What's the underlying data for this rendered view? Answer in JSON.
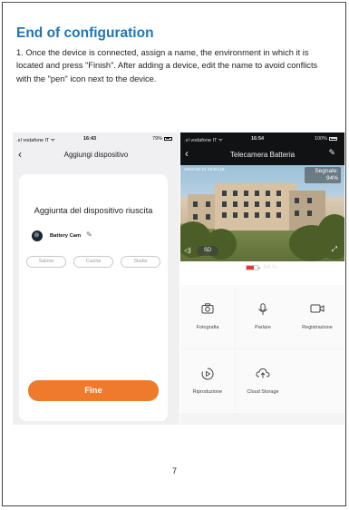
{
  "document": {
    "heading": "End of configuration",
    "intro": "1. Once the device is connected, assign a name, the environment in which it is located and press \"Finish\". After adding a device, edit the name to avoid conflicts with the \"pen\" icon next to the device.",
    "page_number": "7"
  },
  "left_phone": {
    "status_bar": {
      "carrier": ".ııl vodafone IT ᯤ",
      "time": "16:43",
      "battery": "79%"
    },
    "title": "Aggiungi dispositivo",
    "back_icon": "chevron-left-icon",
    "success_text": "Aggiunta del dispositivo riuscita",
    "device_name": "Battery Cam",
    "pen_icon": "pen-icon",
    "rooms": [
      "Salone",
      "Cucina",
      "Studio"
    ],
    "finish_button": "Fine",
    "accent_color": "#f07a2c"
  },
  "right_phone": {
    "status_bar": {
      "carrier": ".ııl vodafone IT ᯤ",
      "time": "16:54",
      "battery": "100%"
    },
    "title": "Telecamera Batteria",
    "back_icon": "chevron-left-icon",
    "edit_icon": "pen-icon",
    "video": {
      "timestamp": "2019-03-21  16:54:16",
      "signal_label": "Segnale:",
      "signal_value": "94%",
      "quality": "SD"
    },
    "battery_text": "64 %",
    "battery_level": 0.64,
    "actions": [
      {
        "label": "Fotografia",
        "icon": "camera-icon"
      },
      {
        "label": "Parlare",
        "icon": "microphone-icon"
      },
      {
        "label": "Registrazione",
        "icon": "video-icon"
      },
      {
        "label": "Riproduzione",
        "icon": "playback-icon"
      },
      {
        "label": "Cloud Storage",
        "icon": "cloud-upload-icon"
      }
    ]
  }
}
